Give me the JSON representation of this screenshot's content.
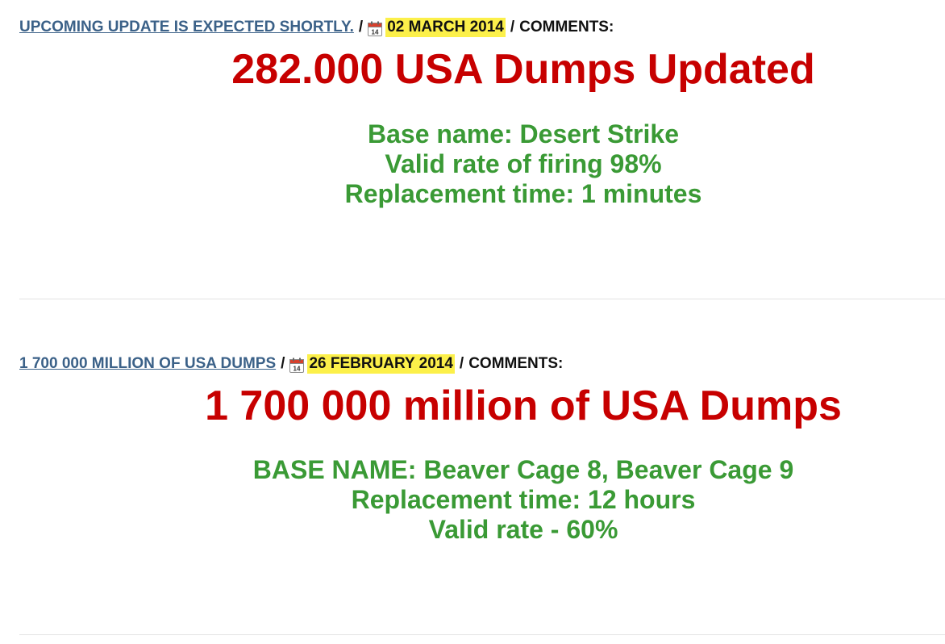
{
  "posts": [
    {
      "title_link": "UPCOMING UPDATE IS EXPECTED SHORTLY.",
      "separator_1": "/",
      "date": "02 MARCH 2014",
      "separator_2": "/",
      "comments_label": "COMMENTS:",
      "headline": "282.000 USA Dumps Updated",
      "details": [
        "Base name: Desert Strike",
        "Valid rate of firing 98%",
        "Replacement time: 1 minutes"
      ]
    },
    {
      "title_link": "1 700 000 MILLION OF USA DUMPS",
      "separator_1": "/",
      "date": "26 FEBRUARY 2014",
      "separator_2": "/",
      "comments_label": "COMMENTS:",
      "headline": "1 700 000 million of USA Dumps",
      "details": [
        "BASE NAME: Beaver Cage 8, Beaver Cage 9",
        "Replacement time: 12 hours",
        "Valid rate - 60%"
      ]
    }
  ],
  "icons": {
    "calendar": "calendar-icon",
    "calendar_day": "14"
  },
  "colors": {
    "link": "#3b6188",
    "date_highlight": "#fcf04a",
    "headline": "#c70000",
    "details": "#3a9a35",
    "divider": "#e3e3e3"
  }
}
